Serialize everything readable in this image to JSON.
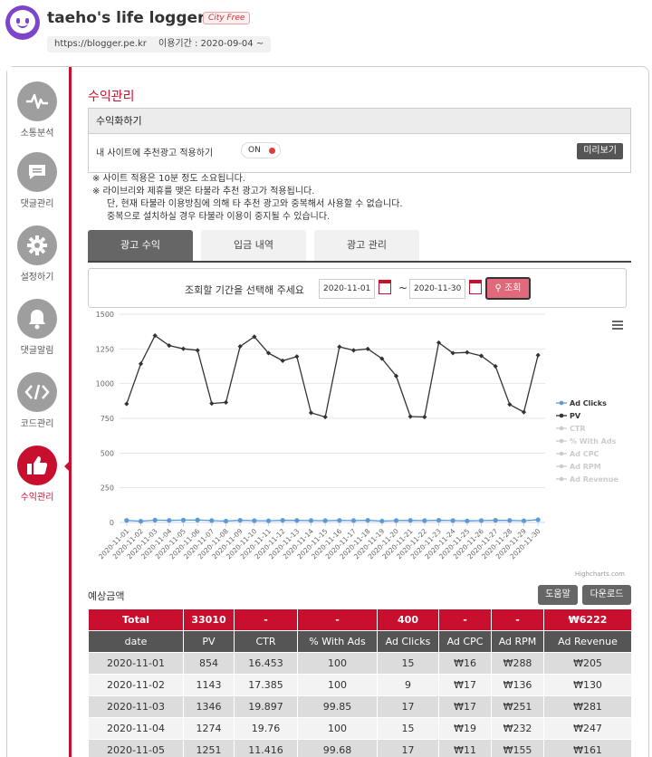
{
  "header": {
    "title": "taeho's life logger",
    "badge": "City Free",
    "url": "https://blogger.pe.kr",
    "period": "이용기간 : 2020-09-04 ~"
  },
  "sidebar": {
    "items": [
      {
        "label": "소통분석",
        "icon": "pulse-icon"
      },
      {
        "label": "댓글관리",
        "icon": "comment-icon"
      },
      {
        "label": "설정하기",
        "icon": "gear-icon"
      },
      {
        "label": "댓글알림",
        "icon": "bell-icon"
      },
      {
        "label": "코드관리",
        "icon": "code-icon"
      },
      {
        "label": "수익관리",
        "icon": "thumbs-up-icon"
      }
    ],
    "active": "수익관리"
  },
  "main": {
    "section_title": "수익관리",
    "monetize_header": "수익화하기",
    "monetize_label": "내 사이트에 추천광고 적용하기",
    "toggle_label": "ON",
    "preview_button": "미리보기",
    "notes": [
      "※ 사이트 적용은 10분 정도 소요됩니다.",
      "※ 라이브리와 제휴를 맺은 타불라 추천 광고가 적용됩니다.",
      "단, 현재 타불라 이용방침에 의해 타 추천 광고와 중복해서 사용할 수 없습니다.",
      "중복으로 설치하실 경우 타불라 이용이 중지될 수 있습니다."
    ],
    "tabs": [
      "광고 수익",
      "입금 내역",
      "광고 관리"
    ],
    "active_tab": "광고 수익",
    "query_label": "조회할 기간을 선택해 주세요",
    "date_from": "2020-11-01",
    "date_to": "2020-11-30",
    "tilde": "~",
    "query_button": "조회",
    "estimate_title": "예상금액",
    "help_button": "도움말",
    "download_button": "다운로드"
  },
  "chart_data": {
    "type": "line",
    "credit": "Highcharts.com",
    "ylim": [
      0,
      1500
    ],
    "yticks": [
      "0",
      "250",
      "500",
      "750",
      "1000",
      "1250",
      "1500"
    ],
    "grid": true,
    "legend_position": "right",
    "categories": [
      "2020-11-01",
      "2020-11-02",
      "2020-11-03",
      "2020-11-04",
      "2020-11-05",
      "2020-11-06",
      "2020-11-07",
      "2020-11-08",
      "2020-11-09",
      "2020-11-10",
      "2020-11-11",
      "2020-11-12",
      "2020-11-13",
      "2020-11-14",
      "2020-11-15",
      "2020-11-16",
      "2020-11-17",
      "2020-11-18",
      "2020-11-19",
      "2020-11-20",
      "2020-11-21",
      "2020-11-22",
      "2020-11-23",
      "2020-11-24",
      "2020-11-25",
      "2020-11-26",
      "2020-11-27",
      "2020-11-28",
      "2020-11-29",
      "2020-11-30"
    ],
    "series": [
      {
        "name": "Ad Clicks",
        "color": "#5b9bd5",
        "visible": true,
        "values": [
          15,
          9,
          17,
          15,
          17,
          18,
          14,
          10,
          16,
          13,
          12,
          16,
          15,
          14,
          13,
          15,
          14,
          16,
          10,
          14,
          15,
          13,
          16,
          14,
          11,
          14,
          16,
          15,
          12,
          20
        ]
      },
      {
        "name": "PV",
        "color": "#333333",
        "visible": true,
        "values": [
          854,
          1143,
          1346,
          1274,
          1251,
          1240,
          857,
          865,
          1268,
          1338,
          1220,
          1165,
          1195,
          790,
          760,
          1265,
          1240,
          1250,
          1180,
          1055,
          763,
          760,
          1295,
          1220,
          1225,
          1200,
          1125,
          850,
          795,
          1205
        ]
      },
      {
        "name": "CTR",
        "color": "#cccccc",
        "visible": false,
        "values": []
      },
      {
        "name": "% With Ads",
        "color": "#cccccc",
        "visible": false,
        "values": []
      },
      {
        "name": "Ad CPC",
        "color": "#cccccc",
        "visible": false,
        "values": []
      },
      {
        "name": "Ad RPM",
        "color": "#cccccc",
        "visible": false,
        "values": []
      },
      {
        "name": "Ad Revenue",
        "color": "#cccccc",
        "visible": false,
        "values": []
      }
    ]
  },
  "table": {
    "total_row": [
      "Total",
      "33010",
      "-",
      "-",
      "400",
      "-",
      "-",
      "₩6222"
    ],
    "columns": [
      "date",
      "PV",
      "CTR",
      "% With Ads",
      "Ad Clicks",
      "Ad CPC",
      "Ad RPM",
      "Ad Revenue"
    ],
    "rows": [
      [
        "2020-11-01",
        "854",
        "16.453",
        "100",
        "15",
        "₩16",
        "₩288",
        "₩205"
      ],
      [
        "2020-11-02",
        "1143",
        "17.385",
        "100",
        "9",
        "₩17",
        "₩136",
        "₩130"
      ],
      [
        "2020-11-03",
        "1346",
        "19.897",
        "99.85",
        "17",
        "₩17",
        "₩251",
        "₩281"
      ],
      [
        "2020-11-04",
        "1274",
        "19.76",
        "100",
        "15",
        "₩19",
        "₩232",
        "₩247"
      ],
      [
        "2020-11-05",
        "1251",
        "11.416",
        "99.68",
        "17",
        "₩11",
        "₩155",
        "₩161"
      ]
    ]
  }
}
